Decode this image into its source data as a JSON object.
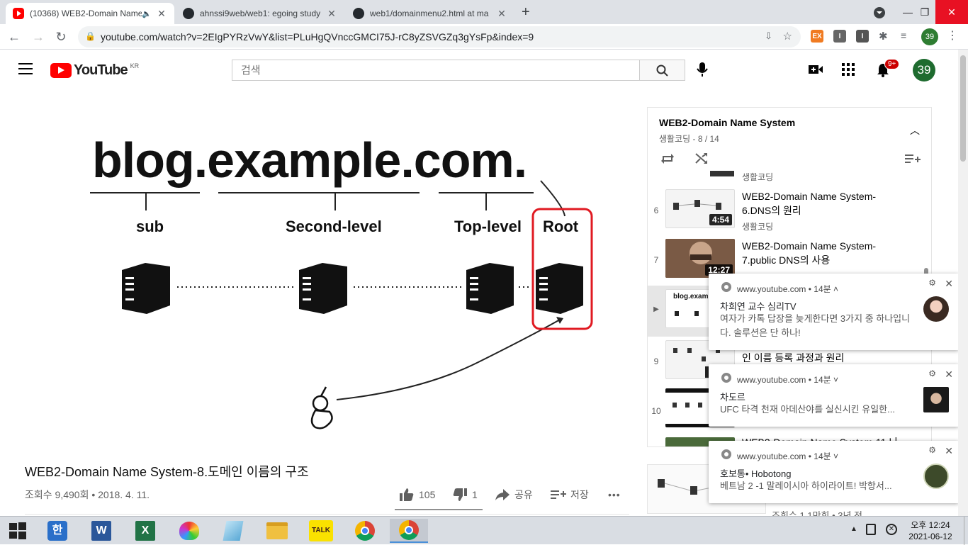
{
  "browser": {
    "tabs": [
      {
        "title": "(10368) WEB2-Domain Name",
        "favicon": "youtube-icon",
        "active": true
      },
      {
        "title": "ahnssi9web/web1: egoing study",
        "favicon": "github-icon"
      },
      {
        "title": "web1/domainmenu2.html at ma",
        "favicon": "github-icon"
      }
    ],
    "new_tab": "+",
    "url": "youtube.com/watch?v=2EIgPYRzVwY&list=PLuHgQVnccGMCI75J-rC8yZSVGZq3gYsFp&index=9",
    "profile_badge": "39",
    "ext_labels": [
      "EX",
      "I",
      "I"
    ]
  },
  "youtube": {
    "logo_text": "YouTube",
    "region": "KR",
    "search_placeholder": "검색",
    "notif_count": "9+",
    "avatar_label": "39"
  },
  "video": {
    "slide": {
      "domain": "blog.example.com.",
      "labels": [
        "sub",
        "Second-level",
        "Top-level",
        "Root"
      ]
    },
    "title": "WEB2-Domain Name System-8.도메인 이름의 구조",
    "meta": "조회수 9,490회 • 2018. 4. 11.",
    "likes": "105",
    "dislikes": "1",
    "share": "공유",
    "save": "저장",
    "more": "•••"
  },
  "playlist": {
    "title": "WEB2-Domain Name System",
    "subtitle": "생활코딩 - 8 / 14",
    "items": [
      {
        "index": "",
        "title": "",
        "channel": "생활코딩",
        "duration": ""
      },
      {
        "index": "6",
        "title": "WEB2-Domain Name System-6.DNS의 원리",
        "channel": "생활코딩",
        "duration": "4:54"
      },
      {
        "index": "7",
        "title": "WEB2-Domain Name System-7.public DNS의 사용",
        "channel": "생활코딩",
        "duration": "12:27"
      },
      {
        "index": "▶",
        "title": "",
        "channel": "",
        "duration": "",
        "thumb_text": "blog.exampl"
      },
      {
        "index": "9",
        "title": "인 이름 등록 과정과 원리",
        "channel": "",
        "duration": ""
      },
      {
        "index": "10",
        "title": "",
        "channel": "",
        "duration": ""
      },
      {
        "index": "",
        "title": "WEB2-Domain Name System-11.나",
        "channel": "",
        "duration": ""
      }
    ],
    "below_meta": "조회수 1.1만회 • 3년 전"
  },
  "notifications": [
    {
      "source": "www.youtube.com",
      "age": "14분",
      "chevron": "˄",
      "title": "차희연 교수 심리TV",
      "body": "여자가 카톡 답장을 늦게한다면 3가지 중 하나입니다. 솔루션은 단 하나!"
    },
    {
      "source": "www.youtube.com",
      "age": "14분",
      "chevron": "˅",
      "title": "차도르",
      "body": "UFC 타격 천재 아데산야를 실신시킨 유일한..."
    },
    {
      "source": "www.youtube.com",
      "age": "14분",
      "chevron": "˅",
      "title": "호보통• Hobotong",
      "body": "베트남 2 -1 말레이시아 하이라이트! 박항서..."
    }
  ],
  "taskbar": {
    "kakao_label": "TALK",
    "time": "오후 12:24",
    "date": "2021-06-12"
  },
  "colors": {
    "youtube_red": "#ff0000",
    "highlight_box": "#e01a22",
    "avatar_green": "#1e6b2f"
  }
}
